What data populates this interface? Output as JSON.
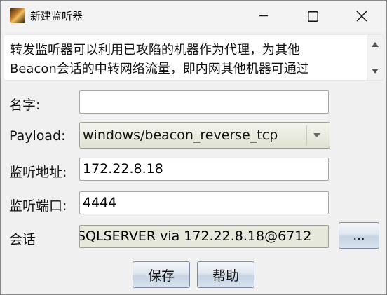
{
  "window": {
    "title": "新建监听器"
  },
  "description": {
    "text": "转发监听器可以利用已攻陷的机器作为代理，为其他\nBeacon会话的中转网络流量，即内网其他机器可通过"
  },
  "form": {
    "name": {
      "label": "名字:",
      "value": ""
    },
    "payload": {
      "label": "Payload:",
      "value": "windows/beacon_reverse_tcp"
    },
    "listen_address": {
      "label": "监听地址:",
      "value": "172.22.8.18"
    },
    "listen_port": {
      "label": "监听端口:",
      "value": "4444"
    },
    "session": {
      "label": "会话",
      "value": "SQLSERVER via  172.22.8.18@6712",
      "browse_label": "..."
    }
  },
  "buttons": {
    "save": "保存",
    "help": "帮助"
  },
  "icons": {
    "app": "app-icon",
    "minimize": "minimize-icon",
    "maximize": "maximize-icon",
    "close": "close-icon",
    "dropdown": "chevron-down-icon",
    "scroll_up": "scroll-up-icon",
    "scroll_down": "scroll-down-icon"
  }
}
